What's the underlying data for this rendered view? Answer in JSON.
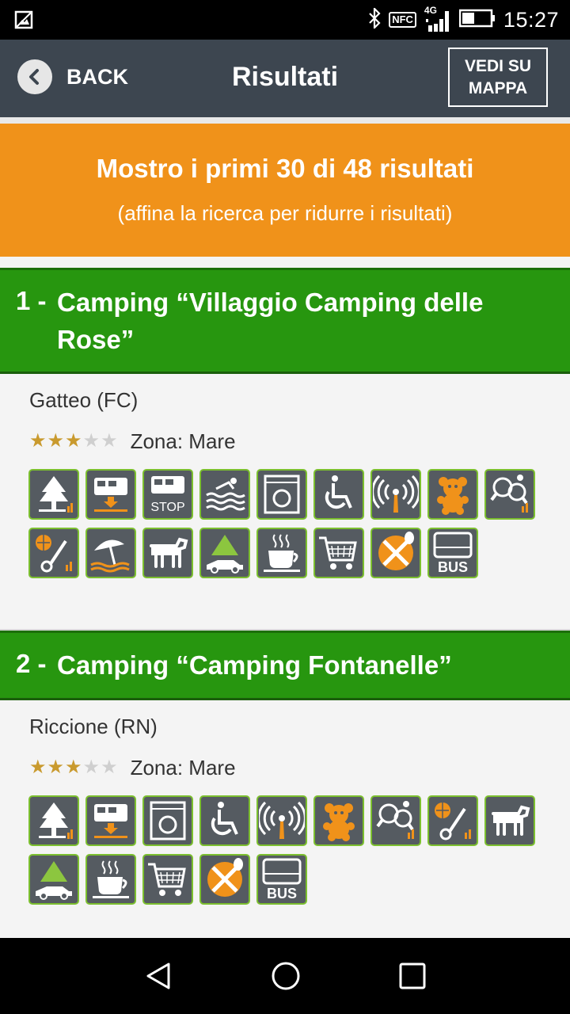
{
  "status_bar": {
    "time": "15:27",
    "network": "4G",
    "nfc": "NFC",
    "icons": [
      "image-icon",
      "bluetooth-icon",
      "nfc-icon",
      "signal-icon",
      "battery-icon"
    ]
  },
  "app_bar": {
    "back_label": "BACK",
    "title": "Risultati",
    "map_button_label": "VEDI SU\nMAPPA"
  },
  "banner": {
    "title": "Mostro i primi 30 di 48 risultati",
    "note": "(affina la ricerca per ridurre i risultati)"
  },
  "results": [
    {
      "number": "1 -",
      "name": "Camping “Villaggio Camping delle Rose”",
      "location": "Gatteo (FC)",
      "stars": 3,
      "max_stars": 5,
      "zona": "Zona: Mare",
      "services": [
        "tent-pitch-icon",
        "camper-service-icon",
        "camper-stop-icon",
        "swimming-pool-icon",
        "laundry-icon",
        "accessible-icon",
        "wifi-icon",
        "kids-club-icon",
        "table-tennis-icon",
        "sports-icon",
        "beach-umbrella-icon",
        "dogs-allowed-icon",
        "car-camping-icon",
        "cafe-icon",
        "shop-icon",
        "restaurant-icon",
        "bus-icon"
      ],
      "bus_label": "BUS",
      "stop_label": "STOP"
    },
    {
      "number": "2 -",
      "name": "Camping “Camping Fontanelle”",
      "location": "Riccione (RN)",
      "stars": 3,
      "max_stars": 5,
      "zona": "Zona: Mare",
      "services": [
        "tent-pitch-icon",
        "camper-service-icon",
        "laundry-icon",
        "accessible-icon",
        "wifi-icon",
        "kids-club-icon",
        "table-tennis-icon",
        "sports-icon",
        "dogs-allowed-icon",
        "car-camping-icon",
        "cafe-icon",
        "shop-icon",
        "restaurant-icon",
        "bus-icon"
      ],
      "bus_label": "BUS"
    }
  ],
  "nav_bar": {
    "icons": [
      "back-triangle-icon",
      "home-circle-icon",
      "recents-square-icon"
    ]
  },
  "colors": {
    "app_bar": "#3d4650",
    "banner": "#f0921a",
    "card_header": "#27960f",
    "icon_bg": "#555b61",
    "icon_border": "#7cbf2f",
    "star": "#c99a2e"
  }
}
